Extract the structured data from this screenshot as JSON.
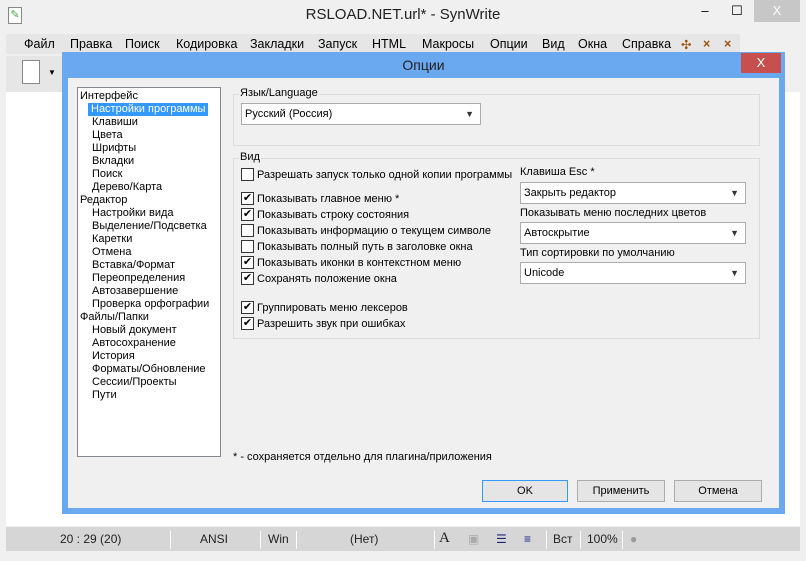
{
  "app": {
    "title": "RSLOAD.NET.url* - SynWrite",
    "minimize": "–",
    "maximize": "☐",
    "close": "X"
  },
  "menu": [
    "Файл",
    "Правка",
    "Поиск",
    "Кодировка",
    "Закладки",
    "Запуск",
    "HTML",
    "Макросы",
    "Опции",
    "Вид",
    "Окна",
    "Справка"
  ],
  "menu_icons": {
    "a": "✣",
    "b": "×",
    "c": "×"
  },
  "statusbar": {
    "position": "20 : 29 (20)",
    "encoding": "ANSI",
    "line_ending": "Win",
    "lexer": "(Нет)",
    "insert_mode": "Вст",
    "zoom": "100%",
    "font_icon": "A"
  },
  "dialog": {
    "title": "Опции",
    "close": "X",
    "tree": [
      {
        "label": "Интерфейс",
        "level": 0
      },
      {
        "label": "Настройки программы",
        "level": 1,
        "selected": true
      },
      {
        "label": "Клавиши",
        "level": 1
      },
      {
        "label": "Цвета",
        "level": 1
      },
      {
        "label": "Шрифты",
        "level": 1
      },
      {
        "label": "Вкладки",
        "level": 1
      },
      {
        "label": "Поиск",
        "level": 1
      },
      {
        "label": "Дерево/Карта",
        "level": 1
      },
      {
        "label": "Редактор",
        "level": 0
      },
      {
        "label": "Настройки вида",
        "level": 1
      },
      {
        "label": "Выделение/Подсветка",
        "level": 1
      },
      {
        "label": "Каретки",
        "level": 1
      },
      {
        "label": "Отмена",
        "level": 1
      },
      {
        "label": "Вставка/Формат",
        "level": 1
      },
      {
        "label": "Переопределения",
        "level": 1
      },
      {
        "label": "Автозавершение",
        "level": 1
      },
      {
        "label": "Проверка орфографии",
        "level": 1
      },
      {
        "label": "Файлы/Папки",
        "level": 0
      },
      {
        "label": "Новый документ",
        "level": 1
      },
      {
        "label": "Автосохранение",
        "level": 1
      },
      {
        "label": "История",
        "level": 1
      },
      {
        "label": "Форматы/Обновление",
        "level": 1
      },
      {
        "label": "Сессии/Проекты",
        "level": 1
      },
      {
        "label": "Пути",
        "level": 1
      }
    ],
    "language_group": "Язык/Language",
    "language_value": "Русский (Россия)",
    "view_group": "Вид",
    "checkboxes": [
      {
        "label": "Разрешать запуск только одной копии программы",
        "checked": false
      },
      {
        "label": "Показывать главное меню *",
        "checked": true
      },
      {
        "label": "Показывать строку состояния",
        "checked": true
      },
      {
        "label": "Показывать информацию о текущем символе",
        "checked": false
      },
      {
        "label": "Показывать полный путь в заголовке окна",
        "checked": false
      },
      {
        "label": "Показывать иконки в контекстном меню",
        "checked": true
      },
      {
        "label": "Сохранять положение окна",
        "checked": true
      },
      {
        "label": "Группировать меню лексеров",
        "checked": true
      },
      {
        "label": "Разрешить звук при ошибках",
        "checked": true
      }
    ],
    "esc_label": "Клавиша Esc *",
    "esc_value": "Закрыть редактор",
    "recent_colors_label": "Показывать меню последних цветов",
    "recent_colors_value": "Автоскрытие",
    "sort_label": "Тип сортировки по умолчанию",
    "sort_value": "Unicode",
    "footnote": "* - сохраняется отдельно для плагина/приложения",
    "ok": "OK",
    "apply": "Применить",
    "cancel": "Отмена"
  }
}
